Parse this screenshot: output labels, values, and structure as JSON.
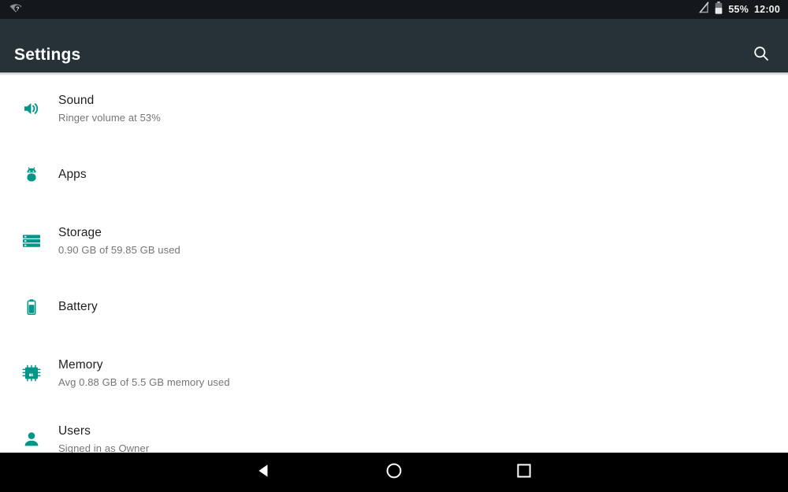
{
  "status_bar": {
    "wifi_icon": "wifi-no-internet-icon",
    "signal_icon": "signal-off-icon",
    "battery_icon": "battery-icon",
    "battery_label": "55%",
    "clock": "12:00"
  },
  "app_bar": {
    "title": "Settings",
    "search_icon": "search-icon"
  },
  "settings_list": [
    {
      "icon": "volume-up-icon",
      "title": "Sound",
      "subtitle": "Ringer volume at 53%"
    },
    {
      "icon": "android-apps-icon",
      "title": "Apps",
      "subtitle": ""
    },
    {
      "icon": "storage-icon",
      "title": "Storage",
      "subtitle": "0.90 GB of 59.85 GB used"
    },
    {
      "icon": "battery-icon",
      "title": "Battery",
      "subtitle": ""
    },
    {
      "icon": "memory-chip-icon",
      "title": "Memory",
      "subtitle": "Avg 0.88 GB of 5.5 GB memory used"
    },
    {
      "icon": "person-icon",
      "title": "Users",
      "subtitle": "Signed in as Owner"
    }
  ],
  "nav_bar": {
    "back_icon": "back-triangle-icon",
    "home_icon": "home-circle-icon",
    "recents_icon": "recents-square-icon"
  },
  "colors": {
    "status_bar_bg": "#15181a",
    "app_bar_bg": "#263238",
    "accent_teal": "#009688",
    "nav_bar_bg": "#000000",
    "primary_text": "#1f1f1f",
    "secondary_text": "#757575"
  }
}
